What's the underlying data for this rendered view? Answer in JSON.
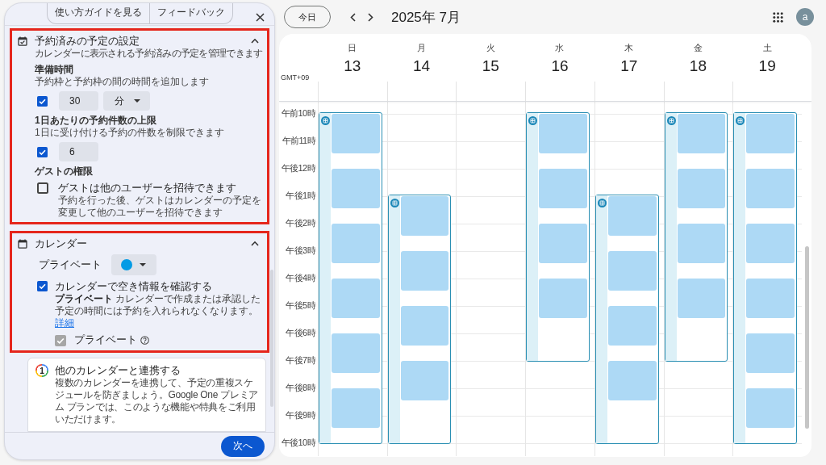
{
  "panel": {
    "header_buttons": [
      "使い方ガイドを見る",
      "フィードバック"
    ],
    "sections": [
      {
        "kind": "booked_settings",
        "highlighted": true,
        "expanded": true,
        "title": "予約済みの予定の設定",
        "subtitle": "カレンダーに表示される予約済みの予定を管理できます",
        "groups": [
          {
            "kind": "duration",
            "label": "準備時間",
            "description": "予約枠と予約枠の間の時間を追加します",
            "checked": true,
            "value": "30",
            "unit": "分"
          },
          {
            "kind": "count",
            "label": "1日あたりの予約件数の上限",
            "description": "1日に受け付ける予約の件数を制限できます",
            "checked": true,
            "value": "6"
          },
          {
            "kind": "permission",
            "label": "ゲストの権限",
            "option": "ゲストは他のユーザーを招待できます",
            "description": "予約を行った後、ゲストはカレンダーの予定を変更して他のユーザーを招待できます",
            "checked": false
          }
        ]
      },
      {
        "kind": "calendar",
        "highlighted": true,
        "expanded": true,
        "title": "カレンダー",
        "calendar_select": {
          "label": "プライベート",
          "color": "#039be5"
        },
        "availability_check": {
          "label": "カレンダーで空き情報を確認する",
          "description": "**プライベート** カレンダーで作成または承認した予定の時間には予約を入れられなくなります。",
          "link": "詳細",
          "checked": true
        },
        "calendars": [
          {
            "label": "プライベート",
            "checked": true,
            "disabled": true
          }
        ]
      }
    ],
    "promo": {
      "badge": "1",
      "title": "他のカレンダーと連携する",
      "body": "複数のカレンダーを連携して、予定の重複スケジュールを防ぎましょう。Google One プレミアム プランでは、このような機能や特典をご利用いただけます。"
    },
    "next_button": "次へ"
  },
  "calendar": {
    "today_button": "今日",
    "month_title": "2025年 7月",
    "avatar": "a",
    "timezone": "GMT+09",
    "hours": [
      "午前10時",
      "午前11時",
      "午後12時",
      "午後1時",
      "午後2時",
      "午後3時",
      "午後4時",
      "午後5時",
      "午後6時",
      "午後7時",
      "午後8時",
      "午後9時",
      "午後10時"
    ],
    "days": [
      {
        "weekday": "日",
        "date": "13",
        "half_hours": [
          {
            "kind": "slot"
          },
          {
            "kind": "slot"
          },
          {
            "kind": "slot"
          },
          {
            "kind": "gap"
          },
          {
            "kind": "slot"
          },
          {
            "kind": "slot"
          },
          {
            "kind": "slot"
          },
          {
            "kind": "gap"
          },
          {
            "kind": "slot"
          },
          {
            "kind": "slot"
          },
          {
            "kind": "slot"
          },
          {
            "kind": "gap"
          },
          {
            "kind": "slot"
          },
          {
            "kind": "slot"
          },
          {
            "kind": "slot"
          },
          {
            "kind": "gap"
          },
          {
            "kind": "slot"
          },
          {
            "kind": "slot"
          },
          {
            "kind": "slot"
          },
          {
            "kind": "gap"
          },
          {
            "kind": "slot"
          },
          {
            "kind": "slot"
          },
          {
            "kind": "slot"
          },
          {
            "kind": "gap"
          }
        ]
      },
      {
        "weekday": "月",
        "date": "14",
        "half_hours": [
          {
            "kind": "off"
          },
          {
            "kind": "off"
          },
          {
            "kind": "off"
          },
          {
            "kind": "off"
          },
          {
            "kind": "off"
          },
          {
            "kind": "off"
          },
          {
            "kind": "slot"
          },
          {
            "kind": "slot"
          },
          {
            "kind": "slot"
          },
          {
            "kind": "gap"
          },
          {
            "kind": "slot"
          },
          {
            "kind": "slot"
          },
          {
            "kind": "slot"
          },
          {
            "kind": "gap"
          },
          {
            "kind": "slot"
          },
          {
            "kind": "slot"
          },
          {
            "kind": "slot"
          },
          {
            "kind": "gap"
          },
          {
            "kind": "slot"
          },
          {
            "kind": "slot"
          },
          {
            "kind": "slot"
          },
          {
            "kind": "gap"
          },
          {
            "kind": "gap"
          },
          {
            "kind": "gap"
          }
        ]
      },
      {
        "weekday": "火",
        "date": "15"
      },
      {
        "weekday": "水",
        "date": "16",
        "half_hours": [
          {
            "kind": "slot"
          },
          {
            "kind": "slot"
          },
          {
            "kind": "slot"
          },
          {
            "kind": "gap"
          },
          {
            "kind": "slot"
          },
          {
            "kind": "slot"
          },
          {
            "kind": "slot"
          },
          {
            "kind": "gap"
          },
          {
            "kind": "slot"
          },
          {
            "kind": "slot"
          },
          {
            "kind": "slot"
          },
          {
            "kind": "gap"
          },
          {
            "kind": "slot"
          },
          {
            "kind": "slot"
          },
          {
            "kind": "slot"
          },
          {
            "kind": "gap"
          },
          {
            "kind": "gap"
          },
          {
            "kind": "gap"
          }
        ]
      },
      {
        "weekday": "木",
        "date": "17",
        "half_hours": [
          {
            "kind": "off"
          },
          {
            "kind": "off"
          },
          {
            "kind": "off"
          },
          {
            "kind": "off"
          },
          {
            "kind": "off"
          },
          {
            "kind": "off"
          },
          {
            "kind": "slot"
          },
          {
            "kind": "slot"
          },
          {
            "kind": "slot"
          },
          {
            "kind": "gap"
          },
          {
            "kind": "slot"
          },
          {
            "kind": "slot"
          },
          {
            "kind": "slot"
          },
          {
            "kind": "gap"
          },
          {
            "kind": "slot"
          },
          {
            "kind": "slot"
          },
          {
            "kind": "slot"
          },
          {
            "kind": "gap"
          },
          {
            "kind": "slot"
          },
          {
            "kind": "slot"
          },
          {
            "kind": "slot"
          },
          {
            "kind": "gap"
          },
          {
            "kind": "gap"
          },
          {
            "kind": "gap"
          }
        ]
      },
      {
        "weekday": "金",
        "date": "18",
        "half_hours": [
          {
            "kind": "slot"
          },
          {
            "kind": "slot"
          },
          {
            "kind": "slot"
          },
          {
            "kind": "gap"
          },
          {
            "kind": "slot"
          },
          {
            "kind": "slot"
          },
          {
            "kind": "slot"
          },
          {
            "kind": "gap"
          },
          {
            "kind": "slot"
          },
          {
            "kind": "slot"
          },
          {
            "kind": "slot"
          },
          {
            "kind": "gap"
          },
          {
            "kind": "slot"
          },
          {
            "kind": "slot"
          },
          {
            "kind": "slot"
          },
          {
            "kind": "gap"
          },
          {
            "kind": "gap"
          },
          {
            "kind": "gap"
          }
        ]
      },
      {
        "weekday": "土",
        "date": "19",
        "half_hours": [
          {
            "kind": "slot"
          },
          {
            "kind": "slot"
          },
          {
            "kind": "slot"
          },
          {
            "kind": "gap"
          },
          {
            "kind": "slot"
          },
          {
            "kind": "slot"
          },
          {
            "kind": "slot"
          },
          {
            "kind": "gap"
          },
          {
            "kind": "slot"
          },
          {
            "kind": "slot"
          },
          {
            "kind": "slot"
          },
          {
            "kind": "gap"
          },
          {
            "kind": "slot"
          },
          {
            "kind": "slot"
          },
          {
            "kind": "slot"
          },
          {
            "kind": "gap"
          },
          {
            "kind": "slot"
          },
          {
            "kind": "slot"
          },
          {
            "kind": "slot"
          },
          {
            "kind": "gap"
          },
          {
            "kind": "slot"
          },
          {
            "kind": "slot"
          },
          {
            "kind": "slot"
          },
          {
            "kind": "gap"
          }
        ]
      }
    ]
  }
}
